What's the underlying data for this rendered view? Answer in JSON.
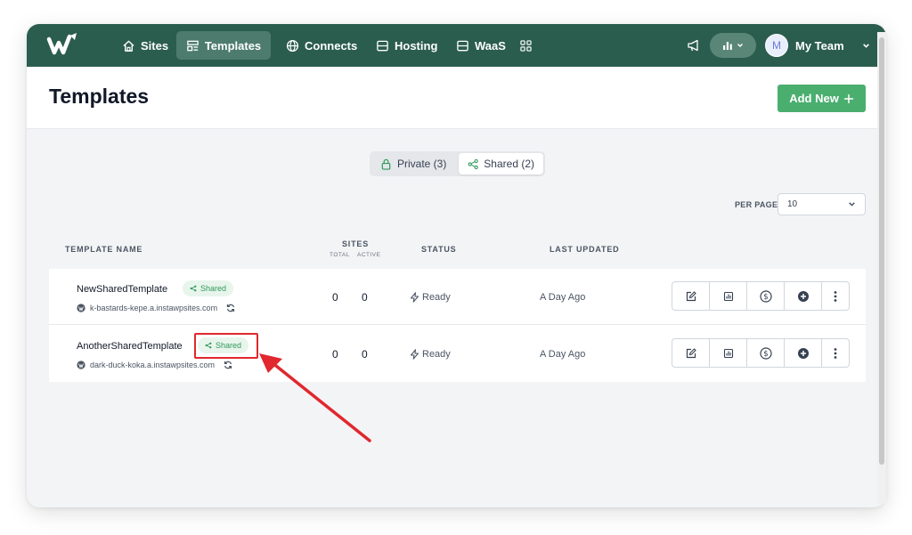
{
  "nav": {
    "items": [
      {
        "label": "Sites",
        "icon": "home-icon"
      },
      {
        "label": "Templates",
        "icon": "templates-icon",
        "active": true
      },
      {
        "label": "Connects",
        "icon": "globe-icon"
      },
      {
        "label": "Hosting",
        "icon": "server-icon"
      },
      {
        "label": "WaaS",
        "icon": "waas-icon"
      }
    ],
    "apps_icon": "grid-icon",
    "announce_icon": "megaphone-icon",
    "stats_icon": "bar-chart-icon",
    "team": {
      "avatar_initial": "M",
      "name": "My Team"
    }
  },
  "header": {
    "title": "Templates",
    "add_new_label": "Add New"
  },
  "filter": {
    "private_label": "Private (3)",
    "shared_label": "Shared (2)",
    "selected": "shared"
  },
  "pagination": {
    "per_page_label": "PER PAGE",
    "per_page_value": "10"
  },
  "table": {
    "columns": {
      "name": "TEMPLATE NAME",
      "sites": "SITES",
      "sites_total": "TOTAL",
      "sites_active": "ACTIVE",
      "status": "STATUS",
      "updated": "LAST UPDATED"
    },
    "rows": [
      {
        "name": "NewSharedTemplate",
        "badge": "Shared",
        "url": "k-bastards-kepe.a.instawpsites.com",
        "total": "0",
        "active": "0",
        "status": "Ready",
        "updated": "A Day Ago"
      },
      {
        "name": "AnotherSharedTemplate",
        "badge": "Shared",
        "url": "dark-duck-koka.a.instawpsites.com",
        "total": "0",
        "active": "0",
        "status": "Ready",
        "updated": "A Day Ago"
      }
    ],
    "row_actions": [
      "edit-icon",
      "report-icon",
      "dollar-icon",
      "add-icon",
      "more-icon"
    ]
  },
  "colors": {
    "nav_bg": "#2b5d4e",
    "accent_green": "#4aae6f",
    "badge_bg": "#e8f5ec",
    "badge_text": "#2f9a5a",
    "annotation_red": "#e0282e"
  }
}
